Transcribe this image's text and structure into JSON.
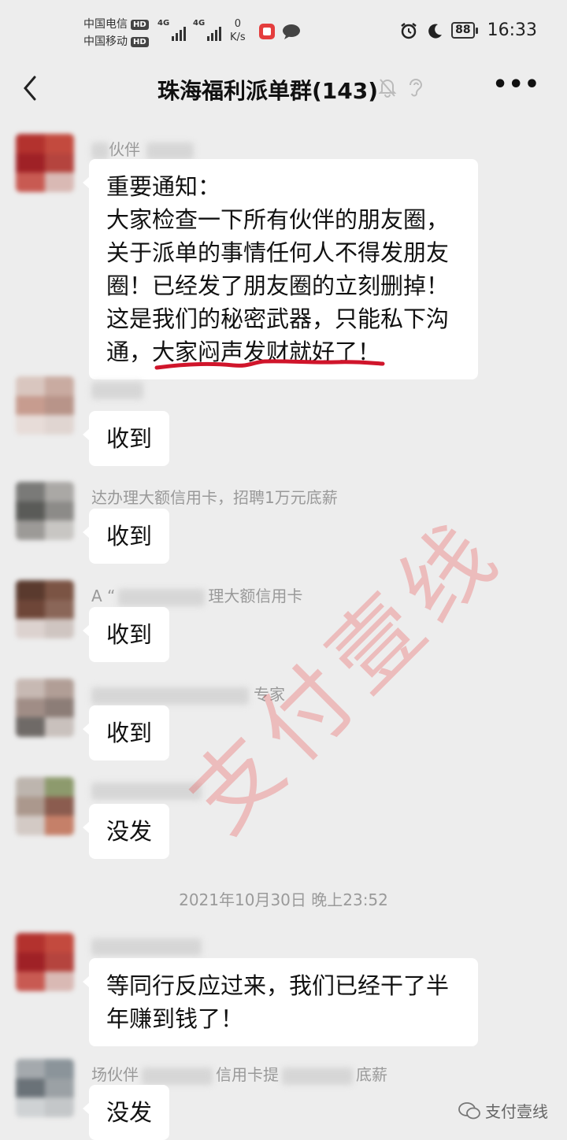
{
  "status_bar": {
    "carrier_1": "中国电信",
    "carrier_2": "中国移动",
    "hd_label": "HD",
    "network_1": "4G",
    "network_2": "4G",
    "speed_value": "0",
    "speed_unit": "K/s",
    "battery": "88",
    "time": "16:33"
  },
  "chat": {
    "title": "珠海福利派单群(143)"
  },
  "messages": [
    {
      "sender": "伙伴",
      "text": "重要通知：\n大家检查一下所有伙伴的朋友圈，\n关于派单的事情任何人不得发朋友\n圈！已经发了朋友圈的立刻删掉！\n这是我们的秘密武器，只能私下沟\n通，大家闷声发财就好了！"
    },
    {
      "sender": "",
      "text": "收到"
    },
    {
      "sender": "达办理大额信用卡，招聘1万元底薪",
      "text": "收到"
    },
    {
      "sender": "A “",
      "sender_suffix": "理大额信用卡",
      "text": "收到"
    },
    {
      "sender": "专家",
      "text": "收到"
    },
    {
      "sender": "",
      "text": "没发"
    },
    {
      "sender": "",
      "text": "等同行反应过来，我们已经干了半\n年赚到钱了！"
    },
    {
      "sender": "场伙伴",
      "sender_suffix": "信用卡提",
      "sender_tail": "底薪",
      "text": "没发"
    }
  ],
  "timestamp": "2021年10月30日 晚上23:52",
  "watermark": "支付壹线",
  "account_mark": "支付壹线",
  "colors": {
    "background": "#ededed",
    "bubble": "#ffffff",
    "underline": "#d0152b",
    "watermark": "#eb3c3c"
  }
}
